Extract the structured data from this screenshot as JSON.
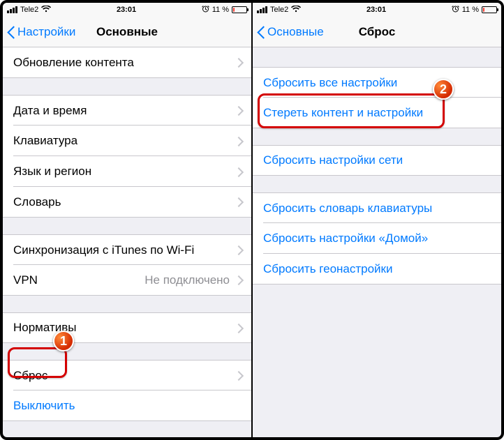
{
  "status": {
    "carrier": "Tele2",
    "time": "23:01",
    "battery_pct": "11 %"
  },
  "left": {
    "back_label": "Настройки",
    "title": "Основные",
    "rows": {
      "content_update": "Обновление контента",
      "date_time": "Дата и время",
      "keyboard": "Клавиатура",
      "lang_region": "Язык и регион",
      "dictionary": "Словарь",
      "itunes_wifi": "Синхронизация с iTunes по Wi-Fi",
      "vpn": "VPN",
      "vpn_value": "Не подключено",
      "regulatory": "Нормативы",
      "reset": "Сброс",
      "shutdown": "Выключить"
    }
  },
  "right": {
    "back_label": "Основные",
    "title": "Сброс",
    "rows": {
      "reset_all": "Сбросить все настройки",
      "erase_all": "Стереть контент и настройки",
      "reset_network": "Сбросить настройки сети",
      "reset_keyboard": "Сбросить словарь клавиатуры",
      "reset_home": "Сбросить настройки «Домой»",
      "reset_location": "Сбросить геонастройки"
    }
  },
  "callouts": {
    "one": "1",
    "two": "2"
  }
}
